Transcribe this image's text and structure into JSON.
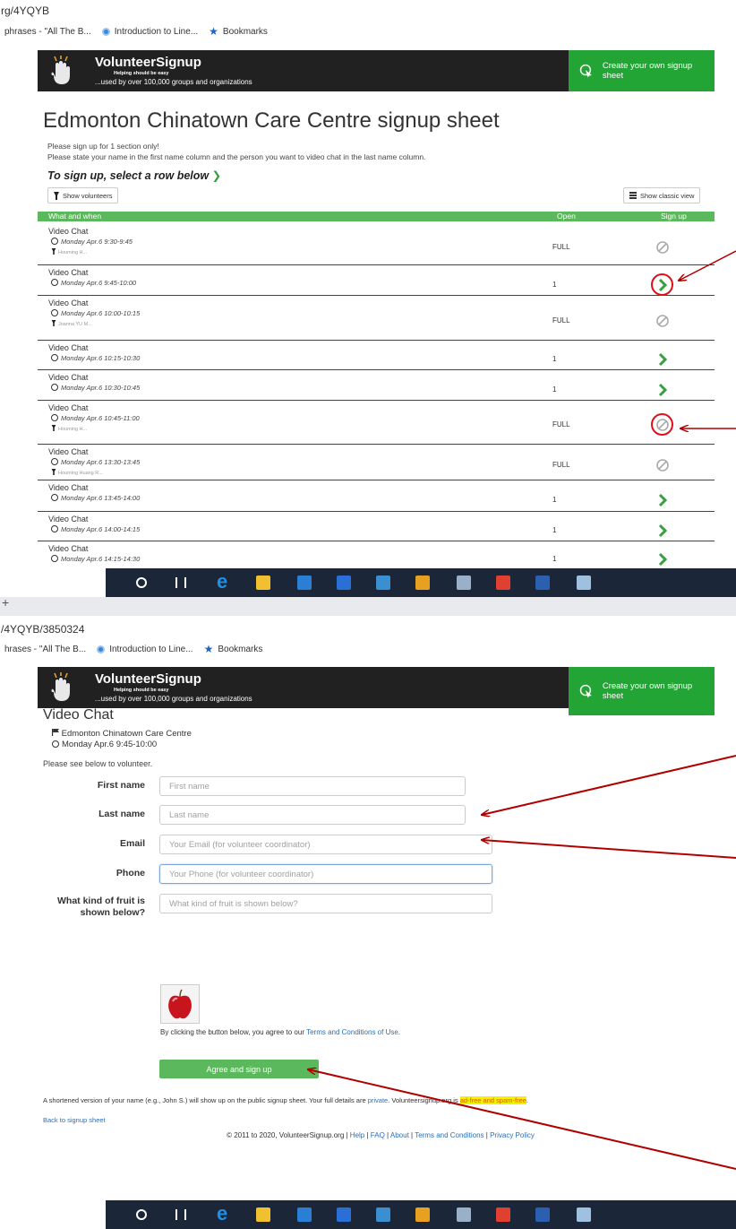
{
  "browser": {
    "top_url": "rg/4YQYB",
    "bottom_url": "/4YQYB/3850324",
    "top_bookmarks": [
      "phrases - \"All The B...",
      "Introduction to Line...",
      "Bookmarks"
    ],
    "bottom_bookmarks": [
      "hrases - \"All The B...",
      "Introduction to Line...",
      "Bookmarks"
    ],
    "new_tab": "+"
  },
  "header": {
    "logo_title": "VolunteerSignup",
    "logo_tagline": "Helping should be easy",
    "logo_sub": "...used by over 100,000 groups and organizations",
    "create_label": "Create your own signup sheet"
  },
  "sheet": {
    "title": "Edmonton Chinatown Care Centre signup sheet",
    "desc1": "Please sign up for 1 section only!",
    "desc2": "Please state your name in the first name column and the person you want to video chat in the last name column.",
    "howto": "To sign up, select a row below",
    "howto_chev": "❯",
    "show_volunteers": "Show volunteers",
    "show_classic": "Show classic view",
    "col_what": "What and when",
    "col_open": "Open",
    "col_sign": "Sign up",
    "rows": [
      {
        "what": "Video Chat",
        "when": "Monday Apr.6 9:30-9:45",
        "who": "Houming H...",
        "open": "FULL",
        "status": "full"
      },
      {
        "what": "Video Chat",
        "when": "Monday Apr.6 9:45-10:00",
        "who": "",
        "open": "1",
        "status": "open"
      },
      {
        "what": "Video Chat",
        "when": "Monday Apr.6 10:00-10:15",
        "who": "Joanna YU M...",
        "open": "FULL",
        "status": "full"
      },
      {
        "what": "Video Chat",
        "when": "Monday Apr.6 10:15-10:30",
        "who": "",
        "open": "1",
        "status": "open"
      },
      {
        "what": "Video Chat",
        "when": "Monday Apr.6 10:30-10:45",
        "who": "",
        "open": "1",
        "status": "open"
      },
      {
        "what": "Video Chat",
        "when": "Monday Apr.6 10:45-11:00",
        "who": "Houming H...",
        "open": "FULL",
        "status": "full"
      },
      {
        "what": "Video Chat",
        "when": "Monday Apr.6 13:30-13:45",
        "who": "Houming Huang R...",
        "open": "FULL",
        "status": "full"
      },
      {
        "what": "Video Chat",
        "when": "Monday Apr.6 13:45-14:00",
        "who": "",
        "open": "1",
        "status": "open"
      },
      {
        "what": "Video Chat",
        "when": "Monday Apr.6 14:00-14:15",
        "who": "",
        "open": "1",
        "status": "open"
      },
      {
        "what": "Video Chat",
        "when": "Monday Apr.6 14:15-14:30",
        "who": "",
        "open": "1",
        "status": "open"
      }
    ]
  },
  "form": {
    "title": "Video Chat",
    "org": "Edmonton Chinatown Care Centre",
    "when": "Monday Apr.6 9:45-10:00",
    "see_below": "Please see below to volunteer.",
    "first_label": "First name",
    "first_placeholder": "First name",
    "last_label": "Last name",
    "last_placeholder": "Last name",
    "email_label": "Email",
    "email_placeholder": "Your Email (for volunteer coordinator)",
    "phone_label": "Phone",
    "phone_placeholder": "Your Phone (for volunteer coordinator)",
    "fruit_label": "What kind of fruit is shown below?",
    "fruit_placeholder": "What kind of fruit is shown below?",
    "agree_pre": "By clicking the button below, you agree to our ",
    "agree_link": "Terms and Conditions of Use",
    "agree_post": ".",
    "agree_button": "Agree and sign up",
    "short_pre": "A shortened version of your name (e.g., John S.) will show up on the public signup sheet. Your full details are ",
    "short_link": "private",
    "short_mid": ". Volunteersignup.org is ",
    "short_hl": "ad-free and spam-free",
    "short_post": ".",
    "back_link": "Back to signup sheet",
    "footer_copy": "© 2011 to 2020, VolunteerSignup.org | ",
    "footer_help": "Help",
    "footer_faq": "FAQ",
    "footer_about": "About",
    "footer_terms": "Terms and Conditions",
    "footer_privacy": "Privacy Policy",
    "footer_sep": " | "
  },
  "colors": {
    "header_bg": "#212121",
    "brand_green": "#22a534",
    "table_head": "#5cb85c",
    "annotation_red": "#b00000",
    "taskbar": "#1b2638"
  },
  "taskbar_icons": [
    "search-circle-icon",
    "task-view-icon",
    "edge-icon",
    "file-explorer-icon",
    "store-icon",
    "media-icon",
    "calculator-icon",
    "outlook-icon",
    "app-icon",
    "chrome-icon",
    "word-icon",
    "paint-icon"
  ]
}
